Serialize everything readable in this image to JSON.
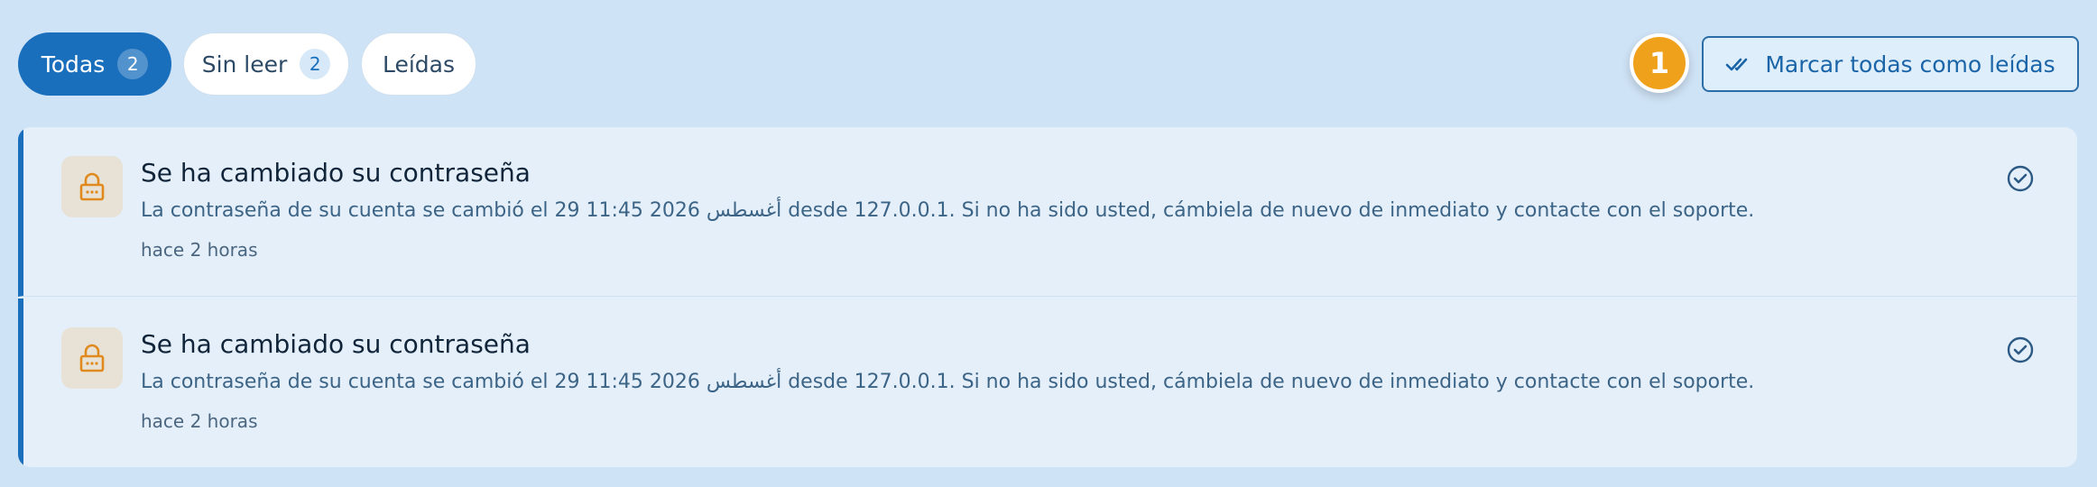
{
  "filters": {
    "all_label": "Todas",
    "all_count": "2",
    "unread_label": "Sin leer",
    "unread_count": "2",
    "read_label": "Leídas"
  },
  "step_badge": "1",
  "mark_all_label": "Marcar todas como leídas",
  "colors": {
    "accent": "#1a6fbd",
    "step_badge": "#f0a11c",
    "lock_icon": "#e08a1e"
  },
  "notifications": [
    {
      "icon": "lock-icon",
      "title": "Se ha cambiado su contraseña",
      "body": "La contraseña de su cuenta se cambió el 29 أغسطس 2026 11:45 desde 127.0.0.1. Si no ha sido usted, cámbiela de nuevo de inmediato y contacte con el soporte.",
      "time": "hace 2 horas"
    },
    {
      "icon": "lock-icon",
      "title": "Se ha cambiado su contraseña",
      "body": "La contraseña de su cuenta se cambió el 29 أغسطس 2026 11:45 desde 127.0.0.1. Si no ha sido usted, cámbiela de nuevo de inmediato y contacte con el soporte.",
      "time": "hace 2 horas"
    }
  ]
}
